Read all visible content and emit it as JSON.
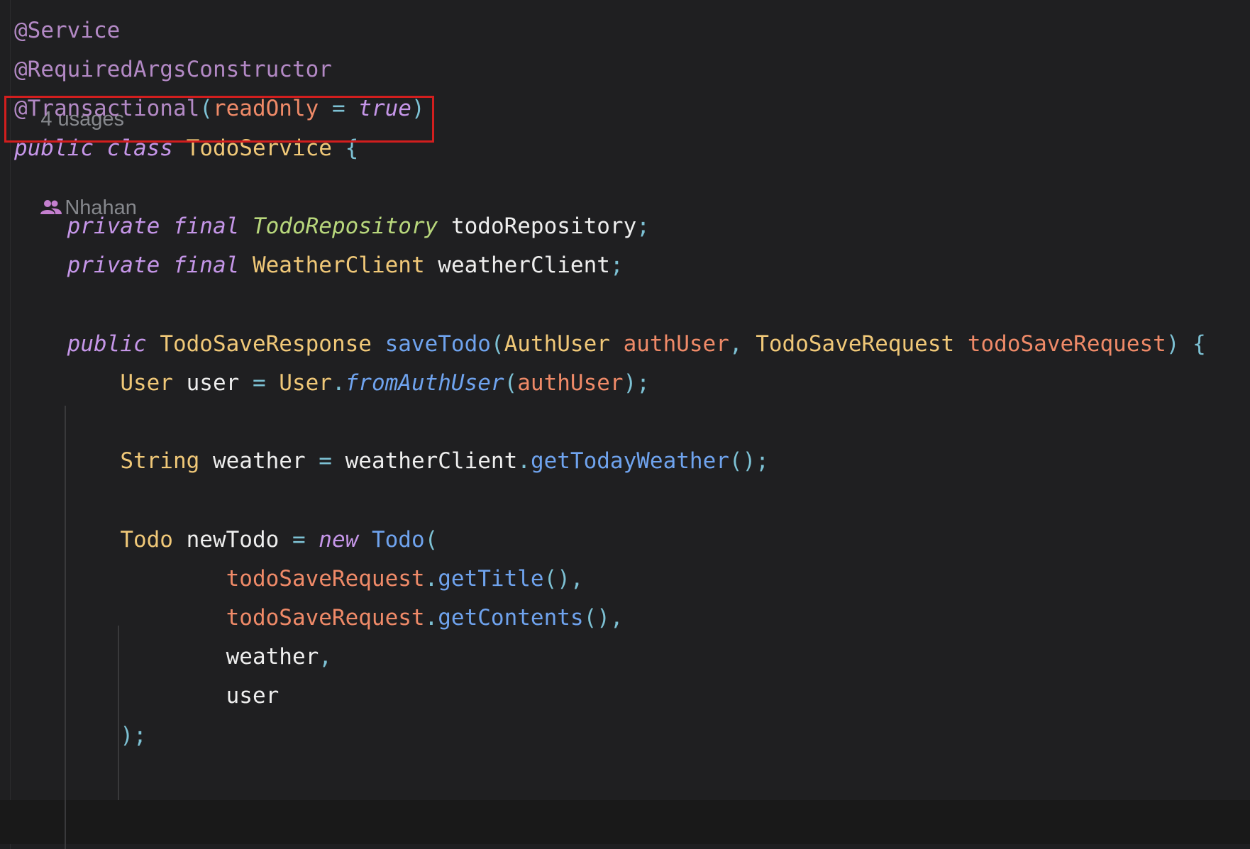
{
  "editor": {
    "usages_hint": "4 usages",
    "author_hint": "Nhahan",
    "colors": {
      "background": "#1f1f21",
      "annotation": "#b389c5",
      "keyword": "#c596e8",
      "class_name": "#f0c878",
      "interface_name": "#b8d77c",
      "method": "#6fa3ee",
      "parameter": "#ef8a68",
      "plain": "#eeeeee",
      "punctuation": "#7dc1d4",
      "highlight_box": "#d21e1e"
    },
    "lines": [
      [
        {
          "text": "@Service",
          "color": "#b389c5"
        }
      ],
      [
        {
          "text": "@RequiredArgsConstructor",
          "color": "#b389c5"
        }
      ],
      [
        {
          "text": "@Transactional",
          "color": "#b389c5"
        },
        {
          "text": "(",
          "color": "#7dc1d4"
        },
        {
          "text": "readOnly",
          "color": "#ef8a68"
        },
        {
          "text": " = ",
          "color": "#7dc1d4"
        },
        {
          "text": "true",
          "color": "#c596e8",
          "italic": true
        },
        {
          "text": ")",
          "color": "#7dc1d4"
        }
      ],
      [
        {
          "text": "public",
          "color": "#c596e8",
          "italic": true
        },
        {
          "text": " "
        },
        {
          "text": "class",
          "color": "#c596e8",
          "italic": true
        },
        {
          "text": " "
        },
        {
          "text": "TodoService",
          "color": "#f0c878"
        },
        {
          "text": " {",
          "color": "#7dc1d4"
        }
      ],
      [],
      [
        {
          "text": "    "
        },
        {
          "text": "private",
          "color": "#c596e8",
          "italic": true
        },
        {
          "text": " "
        },
        {
          "text": "final",
          "color": "#c596e8",
          "italic": true
        },
        {
          "text": " "
        },
        {
          "text": "TodoRepository",
          "color": "#b8d77c",
          "italic": true
        },
        {
          "text": " "
        },
        {
          "text": "todoRepository",
          "color": "#eeeeee"
        },
        {
          "text": ";",
          "color": "#7dc1d4"
        }
      ],
      [
        {
          "text": "    "
        },
        {
          "text": "private",
          "color": "#c596e8",
          "italic": true
        },
        {
          "text": " "
        },
        {
          "text": "final",
          "color": "#c596e8",
          "italic": true
        },
        {
          "text": " "
        },
        {
          "text": "WeatherClient",
          "color": "#f0c878"
        },
        {
          "text": " "
        },
        {
          "text": "weatherClient",
          "color": "#eeeeee"
        },
        {
          "text": ";",
          "color": "#7dc1d4"
        }
      ],
      [],
      [
        {
          "text": "    "
        },
        {
          "text": "public",
          "color": "#c596e8",
          "italic": true
        },
        {
          "text": " "
        },
        {
          "text": "TodoSaveResponse",
          "color": "#f0c878"
        },
        {
          "text": " "
        },
        {
          "text": "saveTodo",
          "color": "#6fa3ee"
        },
        {
          "text": "(",
          "color": "#7dc1d4"
        },
        {
          "text": "AuthUser",
          "color": "#f0c878"
        },
        {
          "text": " "
        },
        {
          "text": "authUser",
          "color": "#ef8a68"
        },
        {
          "text": ", ",
          "color": "#7dc1d4"
        },
        {
          "text": "TodoSaveRequest",
          "color": "#f0c878"
        },
        {
          "text": " "
        },
        {
          "text": "todoSaveRequest",
          "color": "#ef8a68"
        },
        {
          "text": ") {",
          "color": "#7dc1d4"
        }
      ],
      [
        {
          "text": "        "
        },
        {
          "text": "User",
          "color": "#f0c878"
        },
        {
          "text": " "
        },
        {
          "text": "user",
          "color": "#eeeeee"
        },
        {
          "text": " = ",
          "color": "#7dc1d4"
        },
        {
          "text": "User",
          "color": "#f0c878"
        },
        {
          "text": ".",
          "color": "#7dc1d4"
        },
        {
          "text": "fromAuthUser",
          "color": "#6fa3ee",
          "italic": true
        },
        {
          "text": "(",
          "color": "#7dc1d4"
        },
        {
          "text": "authUser",
          "color": "#ef8a68"
        },
        {
          "text": ");",
          "color": "#7dc1d4"
        }
      ],
      [],
      [
        {
          "text": "        "
        },
        {
          "text": "String",
          "color": "#f0c878"
        },
        {
          "text": " "
        },
        {
          "text": "weather",
          "color": "#eeeeee"
        },
        {
          "text": " = ",
          "color": "#7dc1d4"
        },
        {
          "text": "weatherClient",
          "color": "#eeeeee"
        },
        {
          "text": ".",
          "color": "#7dc1d4"
        },
        {
          "text": "getTodayWeather",
          "color": "#6fa3ee"
        },
        {
          "text": "();",
          "color": "#7dc1d4"
        }
      ],
      [],
      [
        {
          "text": "        "
        },
        {
          "text": "Todo",
          "color": "#f0c878"
        },
        {
          "text": " "
        },
        {
          "text": "newTodo",
          "color": "#eeeeee"
        },
        {
          "text": " = ",
          "color": "#7dc1d4"
        },
        {
          "text": "new",
          "color": "#c596e8",
          "italic": true
        },
        {
          "text": " "
        },
        {
          "text": "Todo",
          "color": "#6fa3ee"
        },
        {
          "text": "(",
          "color": "#7dc1d4"
        }
      ],
      [
        {
          "text": "                "
        },
        {
          "text": "todoSaveRequest",
          "color": "#ef8a68"
        },
        {
          "text": ".",
          "color": "#7dc1d4"
        },
        {
          "text": "getTitle",
          "color": "#6fa3ee"
        },
        {
          "text": "(),",
          "color": "#7dc1d4"
        }
      ],
      [
        {
          "text": "                "
        },
        {
          "text": "todoSaveRequest",
          "color": "#ef8a68"
        },
        {
          "text": ".",
          "color": "#7dc1d4"
        },
        {
          "text": "getContents",
          "color": "#6fa3ee"
        },
        {
          "text": "(),",
          "color": "#7dc1d4"
        }
      ],
      [
        {
          "text": "                "
        },
        {
          "text": "weather",
          "color": "#eeeeee"
        },
        {
          "text": ",",
          "color": "#7dc1d4"
        }
      ],
      [
        {
          "text": "                "
        },
        {
          "text": "user",
          "color": "#eeeeee"
        }
      ],
      [
        {
          "text": "        "
        },
        {
          "text": ");",
          "color": "#7dc1d4"
        }
      ]
    ]
  }
}
